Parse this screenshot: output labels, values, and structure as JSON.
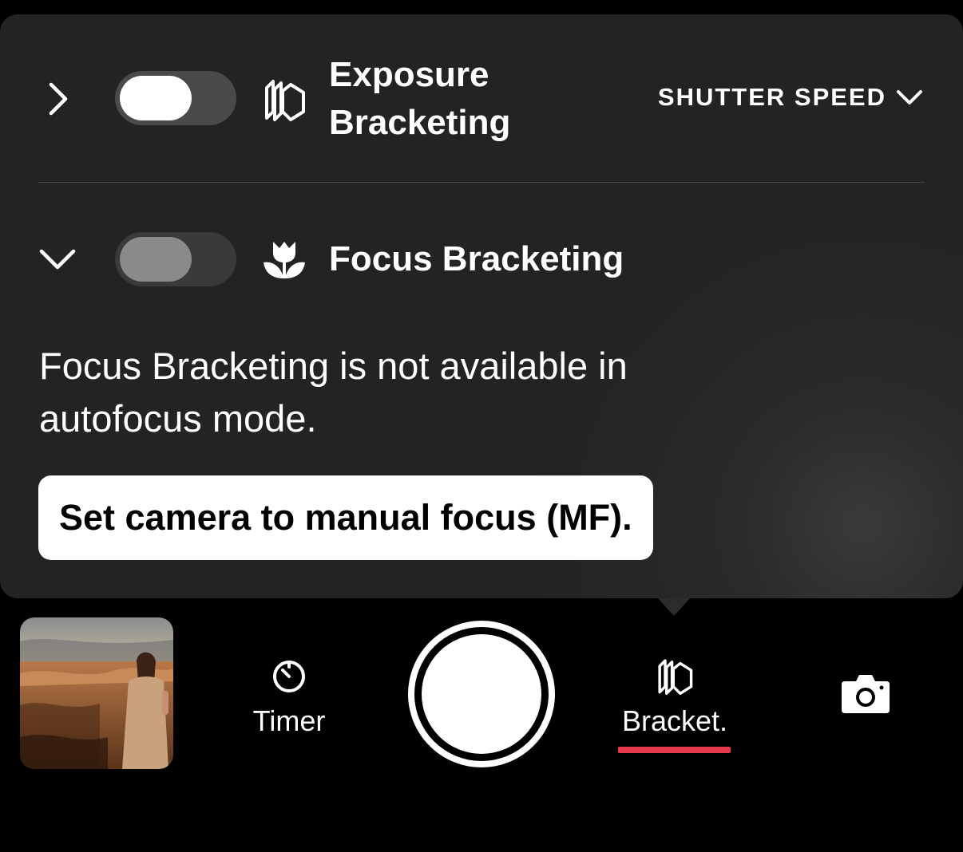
{
  "colors": {
    "panel_bg": "#2a2a2a",
    "accent_underline": "#e8394a",
    "toggle_track": "#4a4a4a",
    "hint_bg": "#ffffff"
  },
  "bracketing": {
    "exposure": {
      "title_line1": "Exposure",
      "title_line2": "Bracketing",
      "expanded": false,
      "toggle_on": false,
      "icon": "stacked-frames-icon",
      "mode_dropdown": "SHUTTER SPEED"
    },
    "focus": {
      "title": "Focus Bracketing",
      "expanded": true,
      "toggle_on": false,
      "disabled": true,
      "icon": "tulip-macro-icon",
      "message": "Focus Bracketing is not available in autofocus mode.",
      "hint": "Set camera to manual focus (MF)."
    }
  },
  "toolbar": {
    "timer_label": "Timer",
    "bracket_label": "Bracket.",
    "active_tool": "Bracket."
  }
}
